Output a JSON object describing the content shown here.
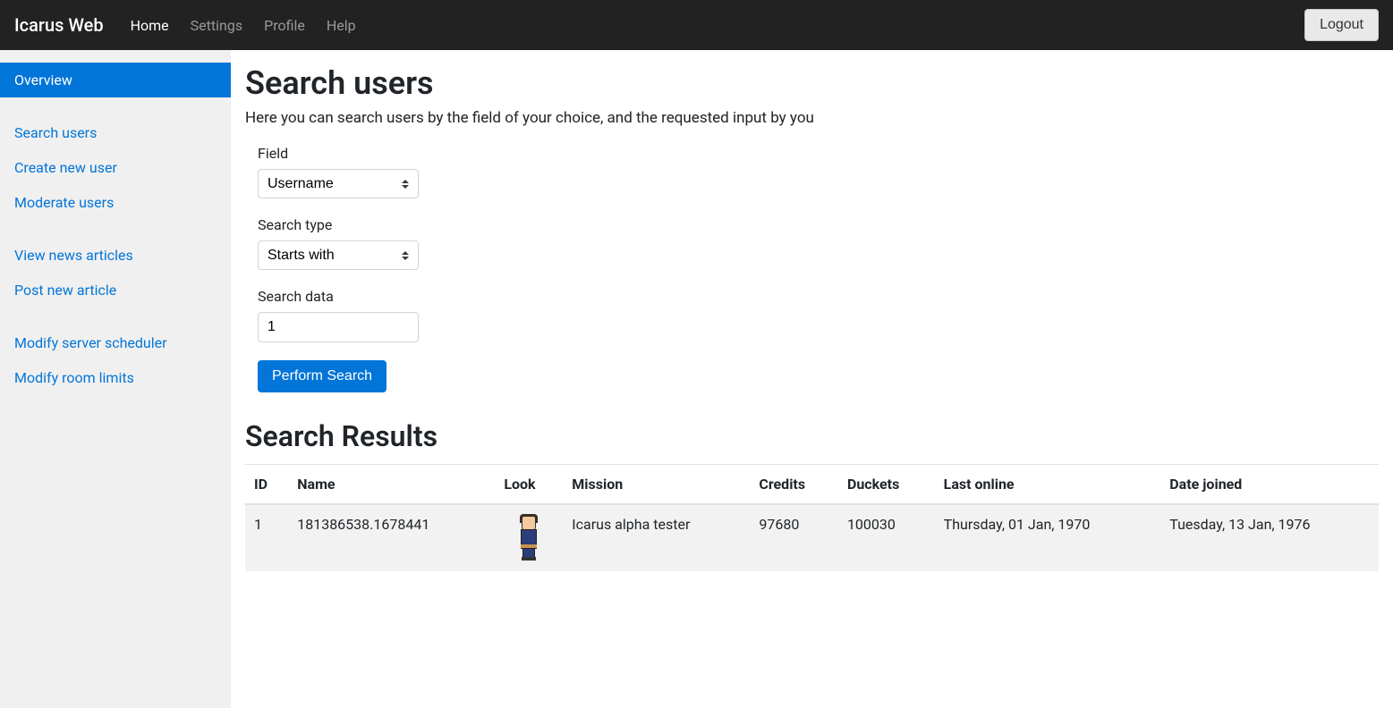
{
  "navbar": {
    "brand": "Icarus Web",
    "links": [
      {
        "label": "Home",
        "active": true
      },
      {
        "label": "Settings",
        "active": false
      },
      {
        "label": "Profile",
        "active": false
      },
      {
        "label": "Help",
        "active": false
      }
    ],
    "logout": "Logout"
  },
  "sidebar": {
    "groups": [
      [
        {
          "label": "Overview",
          "active": true
        }
      ],
      [
        {
          "label": "Search users",
          "active": false
        },
        {
          "label": "Create new user",
          "active": false
        },
        {
          "label": "Moderate users",
          "active": false
        }
      ],
      [
        {
          "label": "View news articles",
          "active": false
        },
        {
          "label": "Post new article",
          "active": false
        }
      ],
      [
        {
          "label": "Modify server scheduler",
          "active": false
        },
        {
          "label": "Modify room limits",
          "active": false
        }
      ]
    ]
  },
  "page": {
    "title": "Search users",
    "description": "Here you can search users by the field of your choice, and the requested input by you"
  },
  "form": {
    "field_label": "Field",
    "field_value": "Username",
    "search_type_label": "Search type",
    "search_type_value": "Starts with",
    "search_data_label": "Search data",
    "search_data_value": "1",
    "submit_label": "Perform Search"
  },
  "results": {
    "title": "Search Results",
    "columns": [
      "ID",
      "Name",
      "Look",
      "Mission",
      "Credits",
      "Duckets",
      "Last online",
      "Date joined"
    ],
    "rows": [
      {
        "id": "1",
        "name": "181386538.1678441",
        "mission": "Icarus alpha tester",
        "credits": "97680",
        "duckets": "100030",
        "last_online": "Thursday, 01 Jan, 1970",
        "date_joined": "Tuesday, 13 Jan, 1976"
      }
    ]
  }
}
